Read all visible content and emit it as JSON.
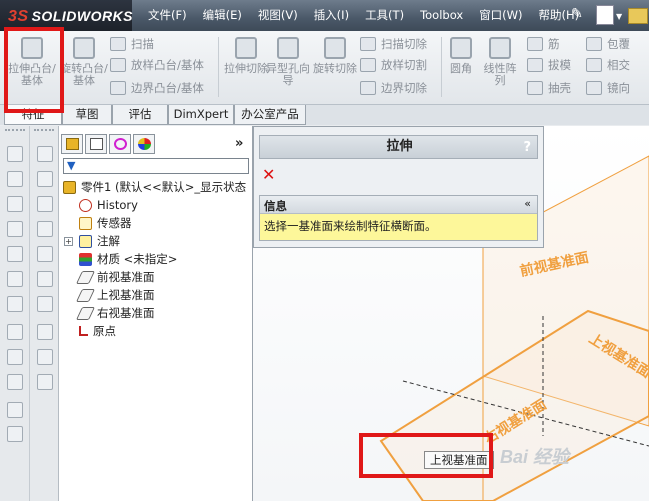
{
  "app": {
    "logo_prefix": "3S",
    "logo_text": "SOLIDWORKS"
  },
  "menu": [
    "文件(F)",
    "编辑(E)",
    "视图(V)",
    "插入(I)",
    "工具(T)",
    "Toolbox",
    "窗口(W)",
    "帮助(H)"
  ],
  "commands": {
    "extrude_boss": "拉伸凸台/基体",
    "revolve_boss": "旋转凸台/基体",
    "sweep": "扫描",
    "loft_boss": "放样凸台/基体",
    "boundary_boss": "边界凸台/基体",
    "extrude_cut": "拉伸切除",
    "hole_wizard": "异型孔向导",
    "revolve_cut": "旋转切除",
    "sweep_cut": "扫描切除",
    "loft_cut": "放样切割",
    "boundary_cut": "边界切除",
    "fillet": "圆角",
    "linear_pattern": "线性阵列",
    "rib": "筋",
    "draft": "拔模",
    "shell": "抽壳",
    "wrap": "包覆",
    "intersect": "相交",
    "mirror": "镜向"
  },
  "tabs": [
    "特征",
    "草图",
    "评估",
    "DimXpert",
    "办公室产品"
  ],
  "feature_tree": {
    "root": "零件1 (默认<<默认>_显示状态",
    "items": [
      "History",
      "传感器",
      "注解",
      "材质 <未指定>",
      "前视基准面",
      "上视基准面",
      "右视基准面",
      "原点"
    ],
    "more": "»"
  },
  "property_manager": {
    "title": "拉伸",
    "help": "?",
    "info_title": "信息",
    "info_collapse": "«",
    "message": "选择一基准面来绘制特征横断面。"
  },
  "graphics": {
    "plane_label_front": "前视基准面",
    "plane_label_top": "上视基准面",
    "plane_label_right": "右视基准面",
    "tooltip": "上视基准面",
    "watermark": "Bai 经验"
  },
  "colors": {
    "plane": "#f0a040",
    "highlight": "#e01818",
    "info_bg": "#fdf79a"
  }
}
